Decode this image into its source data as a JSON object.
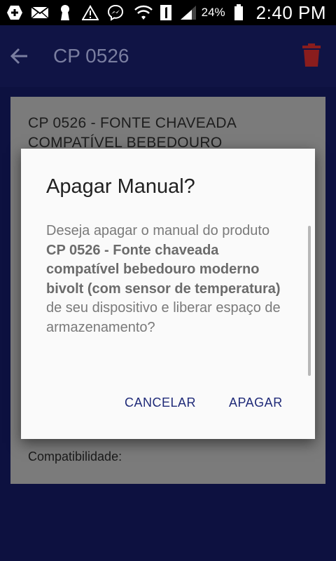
{
  "status_bar": {
    "battery_percent": "24%",
    "time": "2:40 PM"
  },
  "app_bar": {
    "title": "CP 0526"
  },
  "card": {
    "title": "CP 0526 - FONTE CHAVEADA COMPATÍVEL BEBEDOURO",
    "compat_label": "Compatibilidade:"
  },
  "dialog": {
    "title": "Apagar Manual?",
    "message_prefix": "Deseja apagar o manual do produto ",
    "message_bold": "CP 0526 - Fonte chaveada compatível bebedouro moderno bivolt (com sensor de temperatura)",
    "message_suffix": " de seu dispositivo e liberar espaço de armazenamento?",
    "cancel_label": "CANCELAR",
    "confirm_label": "APAGAR"
  },
  "colors": {
    "app_bar": "#1a237e",
    "accent_button": "#283593",
    "delete_icon": "#b71c1c"
  },
  "icons": [
    "add-box-icon",
    "mail-icon",
    "keyhole-icon",
    "warning-icon",
    "messenger-icon",
    "wifi-icon",
    "sim-1-icon",
    "signal-icon",
    "battery-icon",
    "back-arrow-icon",
    "delete-icon"
  ]
}
